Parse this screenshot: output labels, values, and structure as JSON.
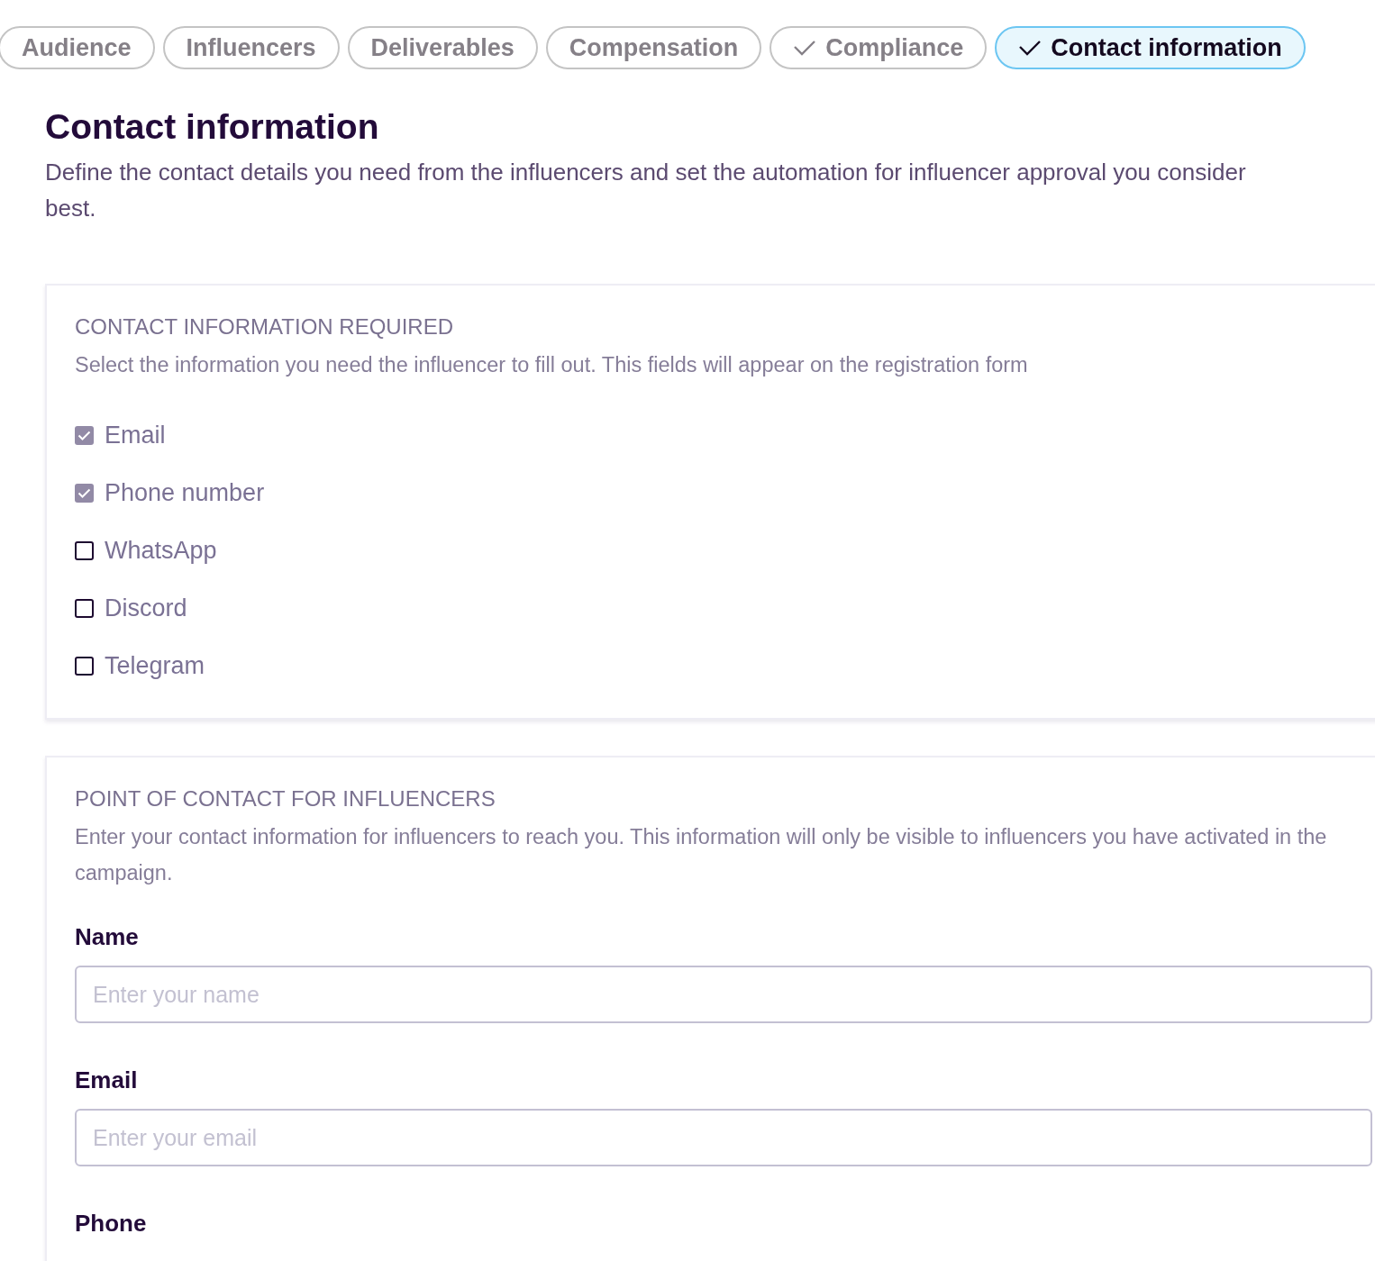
{
  "tabs": [
    {
      "label": "Audience",
      "checked": false,
      "selected": false
    },
    {
      "label": "Influencers",
      "checked": false,
      "selected": false
    },
    {
      "label": "Deliverables",
      "checked": false,
      "selected": false
    },
    {
      "label": "Compensation",
      "checked": false,
      "selected": false
    },
    {
      "label": "Compliance",
      "checked": true,
      "selected": false
    },
    {
      "label": "Contact information",
      "checked": true,
      "selected": true
    }
  ],
  "page": {
    "title": "Contact information",
    "description": "Define the contact details you need from the influencers and set the automation for influencer approval you consider best."
  },
  "required_section": {
    "heading": "CONTACT INFORMATION REQUIRED",
    "description": "Select the information you need the influencer to fill out. This fields will appear on the registration form",
    "options": [
      {
        "label": "Email",
        "checked": true
      },
      {
        "label": "Phone number",
        "checked": true
      },
      {
        "label": "WhatsApp",
        "checked": false
      },
      {
        "label": "Discord",
        "checked": false
      },
      {
        "label": "Telegram",
        "checked": false
      }
    ]
  },
  "contact_section": {
    "heading": "POINT OF CONTACT FOR INFLUENCERS",
    "description": "Enter your contact information for influencers to reach you. This information will only be visible to influencers you have activated in the campaign.",
    "fields": [
      {
        "label": "Name",
        "placeholder": "Enter your name"
      },
      {
        "label": "Email",
        "placeholder": "Enter your email"
      },
      {
        "label": "Phone"
      }
    ]
  }
}
